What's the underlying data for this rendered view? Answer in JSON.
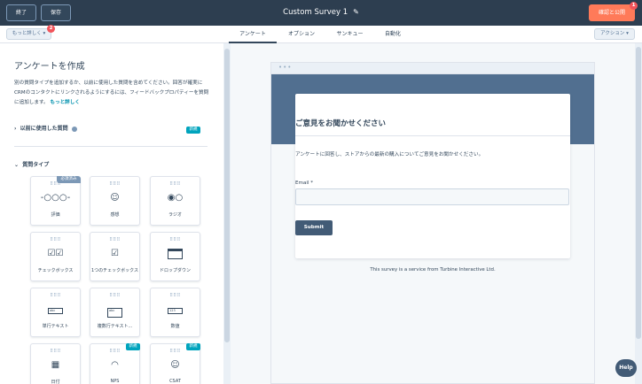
{
  "topbar": {
    "exit_label": "終了",
    "save_label": "保存",
    "title": "Custom Survey 1",
    "publish_label": "確認と公開",
    "publish_badge": "1"
  },
  "tabbar": {
    "more_label": "もっと詳しく ▾",
    "more_badge": "2",
    "tabs": [
      {
        "label": "アンケート",
        "active": true
      },
      {
        "label": "オプション"
      },
      {
        "label": "サンキュー"
      },
      {
        "label": "自動化"
      }
    ],
    "actions_label": "アクション ▾"
  },
  "left_panel": {
    "title": "アンケートを作成",
    "description": "別の質問タイプを追加するか、以前に使用した質問を含めてください。回答が確実にCRMのコンタクトにリンクされるようにするには、フィードバックプロパティーを質問に追加します。",
    "learn_more": "もっと詳しく",
    "section_previous": "以前に使用した質問",
    "section_previous_badge": "新規",
    "section_types": "質問タイプ",
    "question_types": [
      {
        "label": "評価",
        "icon": "rating-icon",
        "badge": "必須済み"
      },
      {
        "label": "感想",
        "icon": "smiley-icon"
      },
      {
        "label": "ラジオ",
        "icon": "radio-icon"
      },
      {
        "label": "チェックボックス",
        "icon": "checkbox-icon"
      },
      {
        "label": "1つのチェックボックス",
        "icon": "single-checkbox-icon"
      },
      {
        "label": "ドロップダウン",
        "icon": "dropdown-icon"
      },
      {
        "label": "単行テキスト",
        "icon": "single-line-text-icon",
        "field_text": "abc"
      },
      {
        "label": "複数行テキスト...",
        "icon": "multi-line-text-icon",
        "field_text": "abc"
      },
      {
        "label": "数値",
        "icon": "number-icon",
        "field_text": "123"
      },
      {
        "label": "日付",
        "icon": "calendar-icon"
      },
      {
        "label": "NPS",
        "icon": "gauge-icon",
        "badge": "新規"
      },
      {
        "label": "CSAT",
        "icon": "smiley-icon",
        "badge": "新規"
      }
    ]
  },
  "preview": {
    "title": "ご意見をお聞かせください",
    "subtitle": "アンケートに回答し、ストアからの最新の購入についてご意見をお聞かせください。",
    "email_label": "Email *",
    "submit_label": "Submit",
    "footer": "This survey is a service from Turbine Interactive Ltd."
  },
  "help_label": "Help",
  "colors": {
    "topbar": "#2d3e50",
    "accent": "#ff7a59",
    "header_band": "#516f90",
    "submit": "#425b76",
    "new_badge": "#00a4bd"
  }
}
